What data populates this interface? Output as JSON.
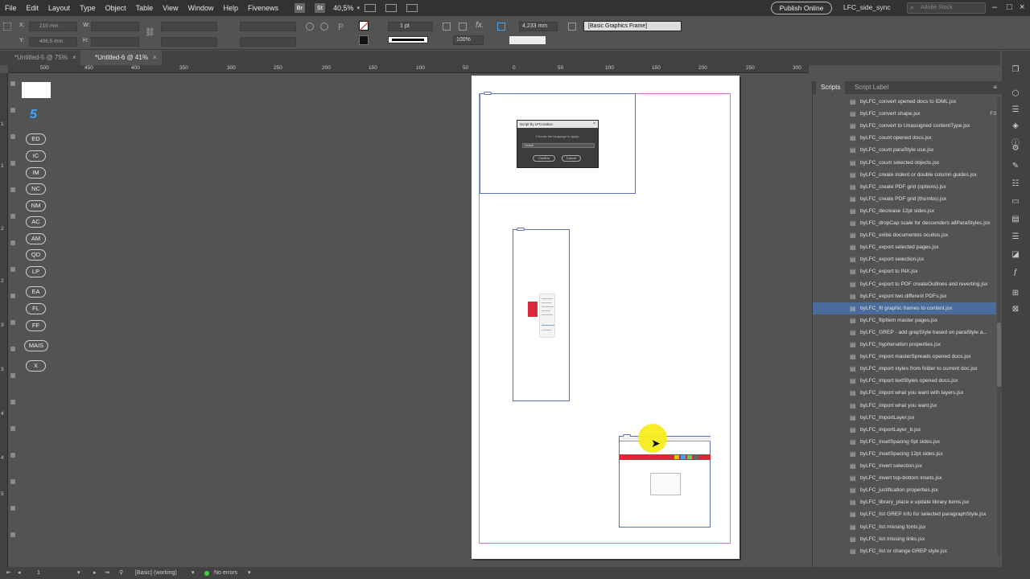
{
  "menubar": {
    "items": [
      "File",
      "Edit",
      "Layout",
      "Type",
      "Object",
      "Table",
      "View",
      "Window",
      "Help",
      "Fivenews"
    ],
    "br": "Br",
    "st": "St",
    "zoom": "40,5%",
    "publish": "Publish Online",
    "workspace": "LFC_side_sync",
    "search_placeholder": "Adobe Stock"
  },
  "control": {
    "x_label": "X:",
    "x_value": "210 mm",
    "y_label": "Y:",
    "y_value": "406,5 mm",
    "w_label": "W:",
    "h_label": "H:",
    "stroke_weight": "1 pt",
    "opacity": "100%",
    "size_value": "4,233 mm",
    "object_style": "[Basic Graphics Frame]"
  },
  "tabs": [
    {
      "label": "*Untitled-5 @ 75%",
      "close": "×"
    },
    {
      "label": "*Untitled-6 @ 41%",
      "close": "×"
    }
  ],
  "ruler": {
    "top": [
      "500",
      "450",
      "400",
      "350",
      "300",
      "250",
      "200",
      "150",
      "100",
      "50",
      "0",
      "50",
      "100",
      "150",
      "200",
      "250",
      "300",
      "350",
      "400",
      "450"
    ],
    "left": [
      "1",
      "1",
      "2",
      "2",
      "3",
      "3",
      "4",
      "4",
      "5"
    ]
  },
  "buttons_panel": {
    "number": "5",
    "pills": [
      "ED",
      "IC",
      "IM",
      "NC",
      "NM",
      "AC",
      "AM",
      "QD",
      "LP",
      "EA",
      "FL",
      "FF",
      "MAIS",
      "X"
    ]
  },
  "dialog": {
    "title": "Script by LFCoration",
    "prompt": "Choose the language to apply:",
    "option": "Default",
    "confirm": "Confirm",
    "cancel": "Cancel",
    "close": "×"
  },
  "scripts_panel": {
    "tab_scripts": "Scripts",
    "tab_label": "Script Label",
    "items": [
      {
        "name": "byLFC_convert opened docs to IDML.jsx",
        "key": ""
      },
      {
        "name": "byLFC_convert shape.jsx",
        "key": "F3"
      },
      {
        "name": "byLFC_convert to Unassigned contentType.jsx",
        "key": ""
      },
      {
        "name": "byLFC_count opened docs.jsx",
        "key": ""
      },
      {
        "name": "byLFC_count paraStyle use.jsx",
        "key": ""
      },
      {
        "name": "byLFC_count selected objects.jsx",
        "key": ""
      },
      {
        "name": "byLFC_create indent or double column guides.jsx",
        "key": ""
      },
      {
        "name": "byLFC_create PDF grid (options).jsx",
        "key": ""
      },
      {
        "name": "byLFC_create PDF grid (thumbs).jsx",
        "key": ""
      },
      {
        "name": "byLFC_decrease 12pt sides.jsx",
        "key": ""
      },
      {
        "name": "byLFC_dropCap scale for descenders allParaStyles.jsx",
        "key": ""
      },
      {
        "name": "byLFC_exibe documentos ocultos.jsx",
        "key": ""
      },
      {
        "name": "byLFC_export selected pages.jsx",
        "key": ""
      },
      {
        "name": "byLFC_export selection.jsx",
        "key": ""
      },
      {
        "name": "byLFC_export to INX.jsx",
        "key": ""
      },
      {
        "name": "byLFC_export to PDF createOutlines and reverting.jsx",
        "key": ""
      },
      {
        "name": "byLFC_export two different PDFs.jsx",
        "key": ""
      },
      {
        "name": "byLFC_fit graphic frames to content.jsx",
        "key": ""
      },
      {
        "name": "byLFC_flipItem master pages.jsx",
        "key": ""
      },
      {
        "name": "byLFC_GREP - add grepStyle based on paraStyle a...",
        "key": ""
      },
      {
        "name": "byLFC_hyphenation properties.jsx",
        "key": ""
      },
      {
        "name": "byLFC_import masterSpreads opened docs.jsx",
        "key": ""
      },
      {
        "name": "byLFC_import styles from folder to current doc.jsx",
        "key": ""
      },
      {
        "name": "byLFC_import textStyles opened docs.jsx",
        "key": ""
      },
      {
        "name": "byLFC_import what you want with layers.jsx",
        "key": ""
      },
      {
        "name": "byLFC_import what you want.jsx",
        "key": ""
      },
      {
        "name": "byLFC_importLayer.jsx",
        "key": ""
      },
      {
        "name": "byLFC_importLayer_b.jsx",
        "key": ""
      },
      {
        "name": "byLFC_insetSpacing 0pt sides.jsx",
        "key": ""
      },
      {
        "name": "byLFC_insetSpacing 12pt sides.jsx",
        "key": ""
      },
      {
        "name": "byLFC_invert selection.jsx",
        "key": ""
      },
      {
        "name": "byLFC_invert top-bottom insets.jsx",
        "key": ""
      },
      {
        "name": "byLFC_justification properties.jsx",
        "key": ""
      },
      {
        "name": "byLFC_library_place e update library items.jsx",
        "key": ""
      },
      {
        "name": "byLFC_list GREP info for selected paragraphStyle.jsx",
        "key": ""
      },
      {
        "name": "byLFC_list missing fonts.jsx",
        "key": ""
      },
      {
        "name": "byLFC_list missing links.jsx",
        "key": ""
      },
      {
        "name": "byLFC_list or change GREP style.jsx",
        "key": ""
      }
    ],
    "selected_index": 17
  },
  "statusbar": {
    "page": "1",
    "mode": "[Basic] (working)",
    "errors": "No errors"
  },
  "colors": {
    "accent_selection": "#4a6c9b",
    "margin_guide": "#e070e0",
    "frame_edge": "#5b6fb5",
    "ok_green": "#3cd23c",
    "highlight_red": "#d9283a"
  }
}
